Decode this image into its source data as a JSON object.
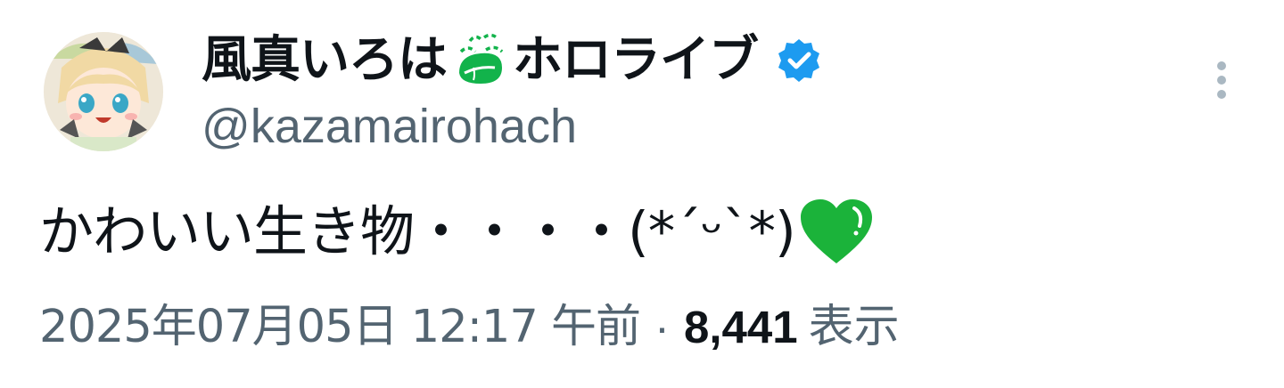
{
  "tweet": {
    "author": {
      "display_name": "風真いろは",
      "affiliation": "ホロライブ",
      "handle": "@kazamairohach",
      "verified": true,
      "avatar_icon": "anime-avatar"
    },
    "text": "かわいい生き物・・・・(*´ᵕ`*)",
    "emoji": "green-heart-icon",
    "date": "2025年07月05日 12:17 午前",
    "separator": "·",
    "views_count": "8,441",
    "views_label": "表示"
  },
  "colors": {
    "text_primary": "#0f1419",
    "text_secondary": "#536471",
    "verified_blue": "#1d9bf0",
    "leaf_green": "#12b34b",
    "heart_green": "#1bb33a"
  }
}
